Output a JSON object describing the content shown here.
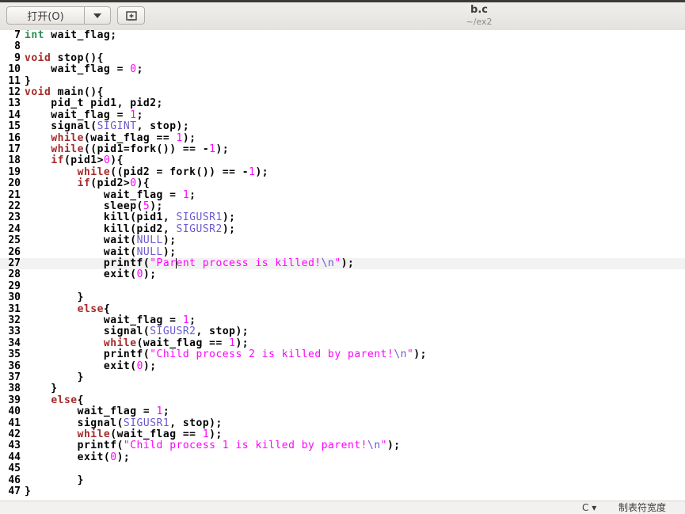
{
  "toolbar": {
    "open_label": "打开(O)",
    "dropdown_icon": "caret-down-icon",
    "new_icon": "new-document-icon"
  },
  "window": {
    "title": "b.c",
    "subtitle": "~/ex2"
  },
  "status": {
    "language": "C ▾",
    "tab_width": "制表符宽度"
  },
  "editor": {
    "current_line": 27,
    "lines": [
      {
        "n": "7",
        "code": "int wait_flag;"
      },
      {
        "n": "8",
        "code": ""
      },
      {
        "n": "9",
        "code": "void stop(){"
      },
      {
        "n": "10",
        "code": "    wait_flag = 0;"
      },
      {
        "n": "11",
        "code": "}"
      },
      {
        "n": "12",
        "code": "void main(){"
      },
      {
        "n": "13",
        "code": "    pid_t pid1, pid2;"
      },
      {
        "n": "14",
        "code": "    wait_flag = 1;"
      },
      {
        "n": "15",
        "code": "    signal(SIGINT, stop);"
      },
      {
        "n": "16",
        "code": "    while(wait_flag == 1);"
      },
      {
        "n": "17",
        "code": "    while((pid1=fork()) == -1);"
      },
      {
        "n": "18",
        "code": "    if(pid1>0){"
      },
      {
        "n": "19",
        "code": "        while((pid2 = fork()) == -1);"
      },
      {
        "n": "20",
        "code": "        if(pid2>0){"
      },
      {
        "n": "21",
        "code": "            wait_flag = 1;"
      },
      {
        "n": "22",
        "code": "            sleep(5);"
      },
      {
        "n": "23",
        "code": "            kill(pid1, SIGUSR1);"
      },
      {
        "n": "24",
        "code": "            kill(pid2, SIGUSR2);"
      },
      {
        "n": "25",
        "code": "            wait(NULL);"
      },
      {
        "n": "26",
        "code": "            wait(NULL);"
      },
      {
        "n": "27",
        "code": "            printf(\"Parent process is killed!\\n\");"
      },
      {
        "n": "28",
        "code": "            exit(0);"
      },
      {
        "n": "29",
        "code": ""
      },
      {
        "n": "30",
        "code": "        }"
      },
      {
        "n": "31",
        "code": "        else{"
      },
      {
        "n": "32",
        "code": "            wait_flag = 1;"
      },
      {
        "n": "33",
        "code": "            signal(SIGUSR2, stop);"
      },
      {
        "n": "34",
        "code": "            while(wait_flag == 1);"
      },
      {
        "n": "35",
        "code": "            printf(\"Child process 2 is killed by parent!\\n\");"
      },
      {
        "n": "36",
        "code": "            exit(0);"
      },
      {
        "n": "37",
        "code": "        }"
      },
      {
        "n": "38",
        "code": "    }"
      },
      {
        "n": "39",
        "code": "    else{"
      },
      {
        "n": "40",
        "code": "        wait_flag = 1;"
      },
      {
        "n": "41",
        "code": "        signal(SIGUSR1, stop);"
      },
      {
        "n": "42",
        "code": "        while(wait_flag == 1);"
      },
      {
        "n": "43",
        "code": "        printf(\"Child process 1 is killed by parent!\\n\");"
      },
      {
        "n": "44",
        "code": "        exit(0);"
      },
      {
        "n": "45",
        "code": ""
      },
      {
        "n": "46",
        "code": "        }"
      },
      {
        "n": "47",
        "code": "}"
      }
    ]
  }
}
